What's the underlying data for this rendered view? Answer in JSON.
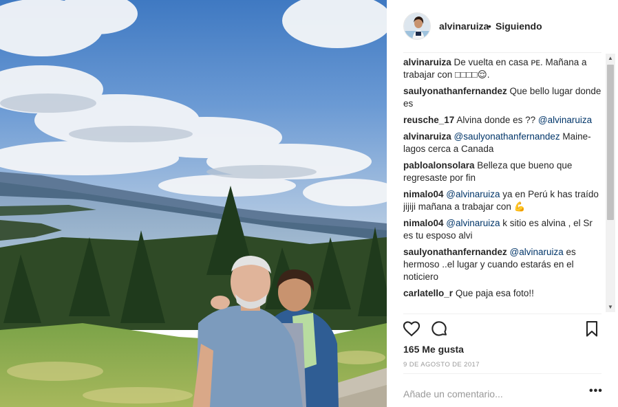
{
  "post": {
    "photo_alt": "Foto del lago",
    "username": "alvinaruiza",
    "separator": "•",
    "follow_status": "Siguiendo",
    "likes": "165 Me gusta",
    "date": "9 de agosto de 2017",
    "add_comment_placeholder": "Añade un comentario...",
    "more_options": "•••"
  },
  "comments": [
    {
      "user": "alvinaruiza",
      "parts": [
        {
          "t": "text",
          "v": "De vuelta en casa ᴘᴇ. Mañana a trabajar con □□□□😌."
        }
      ]
    },
    {
      "user": "saulyonathanfernandez",
      "parts": [
        {
          "t": "text",
          "v": "Que bello lugar donde es"
        }
      ]
    },
    {
      "user": "reusche_17",
      "parts": [
        {
          "t": "text",
          "v": "Alvina donde es ?? "
        },
        {
          "t": "mention",
          "v": "@alvinaruiza"
        }
      ]
    },
    {
      "user": "alvinaruiza",
      "parts": [
        {
          "t": "mention",
          "v": "@saulyonathanfernandez"
        },
        {
          "t": "text",
          "v": " Maine-lagos cerca a Canada"
        }
      ]
    },
    {
      "user": "pabloalonsolara",
      "parts": [
        {
          "t": "text",
          "v": "Belleza que bueno que regresaste por fin"
        }
      ]
    },
    {
      "user": "nimalo04",
      "parts": [
        {
          "t": "mention",
          "v": "@alvinaruiza"
        },
        {
          "t": "text",
          "v": " ya en Perú k has traído jijiji mañana a trabajar con 💪"
        }
      ]
    },
    {
      "user": "nimalo04",
      "parts": [
        {
          "t": "mention",
          "v": "@alvinaruiza"
        },
        {
          "t": "text",
          "v": " k sitio es alvina , el Sr es tu esposo alvi"
        }
      ]
    },
    {
      "user": "saulyonathanfernandez",
      "parts": [
        {
          "t": "mention",
          "v": "@alvinaruiza"
        },
        {
          "t": "text",
          "v": " es hermoso ..el lugar y cuando estarás en el noticiero"
        }
      ]
    },
    {
      "user": "carlatello_r",
      "parts": [
        {
          "t": "text",
          "v": "Que paja esa foto!!"
        }
      ]
    }
  ],
  "icons": {
    "like": "heart-icon",
    "comment": "comment-bubble-icon",
    "save": "bookmark-icon",
    "scroll_up": "▲",
    "scroll_down": "▼"
  },
  "colors": {
    "text": "#262626",
    "mention": "#003569",
    "muted": "#999999",
    "divider": "#efefef"
  }
}
